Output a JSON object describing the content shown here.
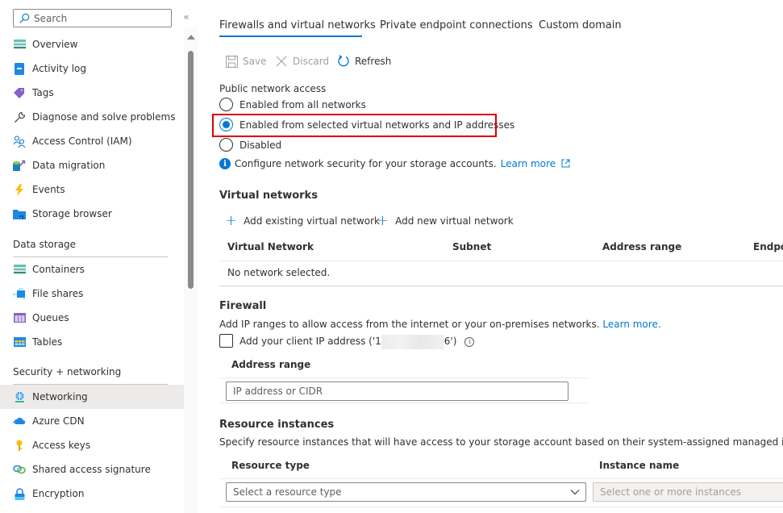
{
  "sidebar": {
    "search_placeholder": "Search",
    "collapse_icon": "«",
    "items": [
      {
        "label": "Overview",
        "icon": "overview-icon"
      },
      {
        "label": "Activity log",
        "icon": "activity-log-icon"
      },
      {
        "label": "Tags",
        "icon": "tag-icon"
      },
      {
        "label": "Diagnose and solve problems",
        "icon": "wrench-icon"
      },
      {
        "label": "Access Control (IAM)",
        "icon": "people-icon"
      },
      {
        "label": "Data migration",
        "icon": "data-migration-icon"
      },
      {
        "label": "Events",
        "icon": "lightning-icon"
      },
      {
        "label": "Storage browser",
        "icon": "storage-browser-icon"
      }
    ],
    "sections": [
      {
        "title": "Data storage",
        "items": [
          {
            "label": "Containers",
            "icon": "containers-icon"
          },
          {
            "label": "File shares",
            "icon": "file-shares-icon"
          },
          {
            "label": "Queues",
            "icon": "queues-icon"
          },
          {
            "label": "Tables",
            "icon": "tables-icon"
          }
        ]
      },
      {
        "title": "Security + networking",
        "items": [
          {
            "label": "Networking",
            "icon": "networking-icon",
            "selected": true
          },
          {
            "label": "Azure CDN",
            "icon": "cloud-icon"
          },
          {
            "label": "Access keys",
            "icon": "key-icon"
          },
          {
            "label": "Shared access signature",
            "icon": "link-icon"
          },
          {
            "label": "Encryption",
            "icon": "lock-icon"
          }
        ]
      }
    ]
  },
  "tabs": [
    {
      "label": "Firewalls and virtual networks",
      "active": true
    },
    {
      "label": "Private endpoint connections",
      "active": false
    },
    {
      "label": "Custom domain",
      "active": false
    }
  ],
  "toolbar": {
    "save_label": "Save",
    "discard_label": "Discard",
    "refresh_label": "Refresh"
  },
  "public_access": {
    "label": "Public network access",
    "options": [
      {
        "label": "Enabled from all networks",
        "checked": false
      },
      {
        "label": "Enabled from selected virtual networks and IP addresses",
        "checked": true
      },
      {
        "label": "Disabled",
        "checked": false
      }
    ],
    "info_text": "Configure network security for your storage accounts.",
    "learn_more": "Learn more"
  },
  "virtual_networks": {
    "title": "Virtual networks",
    "add_existing": "Add existing virtual network",
    "add_new": "Add new virtual network",
    "columns": [
      "Virtual Network",
      "Subnet",
      "Address range",
      "Endpoi"
    ],
    "empty_text": "No network selected."
  },
  "firewall": {
    "title": "Firewall",
    "description": "Add IP ranges to allow access from the internet or your on-premises networks.",
    "learn_more": "Learn more.",
    "client_ip_prefix": "Add your client IP address ('1",
    "client_ip_suffix": "6')",
    "address_range_header": "Address range",
    "address_placeholder": "IP address or CIDR"
  },
  "resource_instances": {
    "title": "Resource instances",
    "description": "Specify resource instances that will have access to your storage account based on their system-assigned managed identity.",
    "resource_type_header": "Resource type",
    "instance_name_header": "Instance name",
    "resource_type_placeholder": "Select a resource type",
    "instance_placeholder": "Select one or more instances"
  },
  "colors": {
    "accent": "#0078d4",
    "highlight": "#e00000",
    "selected_bg": "#edebe9"
  }
}
